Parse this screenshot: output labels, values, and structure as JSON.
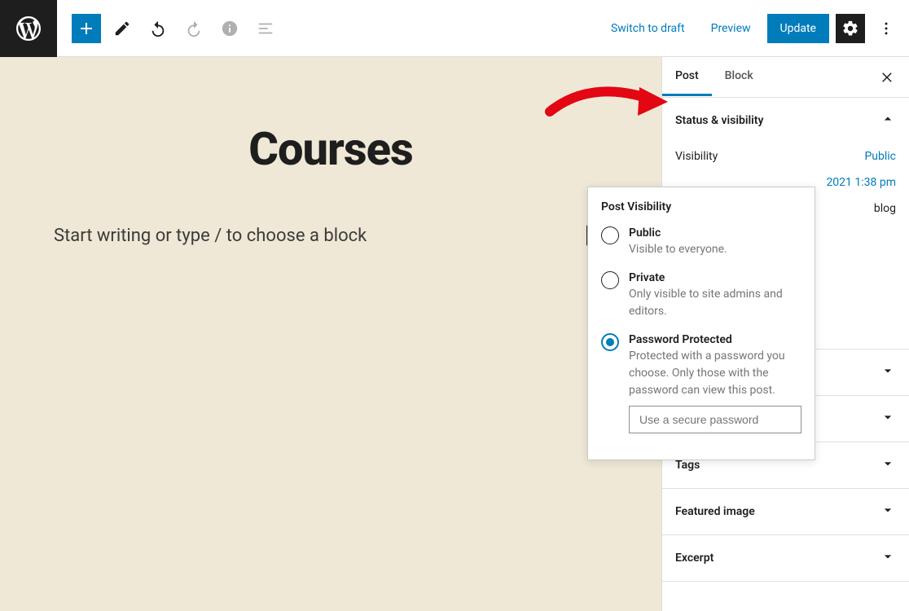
{
  "topbar": {
    "switch_draft": "Switch to draft",
    "preview": "Preview",
    "update": "Update"
  },
  "sidebar": {
    "tabs": {
      "post": "Post",
      "block": "Block"
    },
    "status_visibility": {
      "title": "Status & visibility",
      "visibility_label": "Visibility",
      "visibility_value": "Public",
      "publish_value": "2021 1:38 pm",
      "template_value": "blog"
    },
    "collapsed": {
      "tags": "Tags",
      "featured_image": "Featured image",
      "excerpt": "Excerpt"
    }
  },
  "canvas": {
    "title": "Courses",
    "prompt": "Start writing or type / to choose a block"
  },
  "popover": {
    "title": "Post Visibility",
    "options": [
      {
        "label": "Public",
        "desc": "Visible to everyone.",
        "selected": false
      },
      {
        "label": "Private",
        "desc": "Only visible to site admins and editors.",
        "selected": false
      },
      {
        "label": "Password Protected",
        "desc": "Protected with a password you choose. Only those with the password can view this post.",
        "selected": true
      }
    ],
    "password_placeholder": "Use a secure password"
  }
}
